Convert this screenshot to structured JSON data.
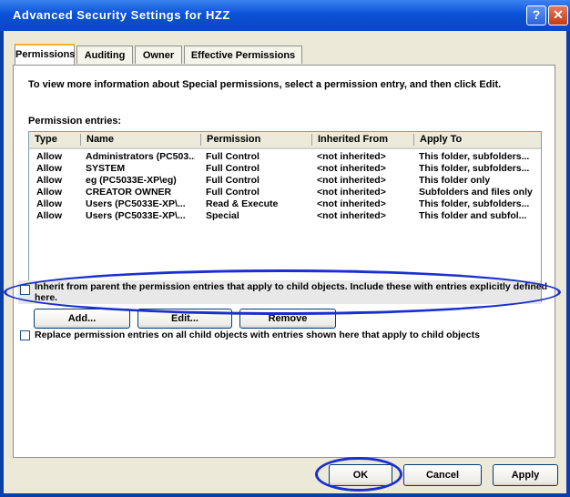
{
  "window": {
    "title": "Advanced Security Settings for HZZ",
    "help_glyph": "?",
    "close_glyph": "✕"
  },
  "tabs": [
    {
      "label": "Permissions"
    },
    {
      "label": "Auditing"
    },
    {
      "label": "Owner"
    },
    {
      "label": "Effective Permissions"
    }
  ],
  "info_text": "To view more information about Special permissions, select a permission entry, and then click Edit.",
  "entries_label": "Permission entries:",
  "columns": [
    "Type",
    "Name",
    "Permission",
    "Inherited From",
    "Apply To"
  ],
  "rows": [
    {
      "type": "Allow",
      "name": "Administrators (PC503...",
      "permission": "Full Control",
      "inherited": "<not inherited>",
      "apply": "This folder, subfolders..."
    },
    {
      "type": "Allow",
      "name": "SYSTEM",
      "permission": "Full Control",
      "inherited": "<not inherited>",
      "apply": "This folder, subfolders..."
    },
    {
      "type": "Allow",
      "name": "eg (PC5033E-XP\\eg)",
      "permission": "Full Control",
      "inherited": "<not inherited>",
      "apply": "This folder only"
    },
    {
      "type": "Allow",
      "name": "CREATOR OWNER",
      "permission": "Full Control",
      "inherited": "<not inherited>",
      "apply": "Subfolders and files only"
    },
    {
      "type": "Allow",
      "name": "Users (PC5033E-XP\\...",
      "permission": "Read & Execute",
      "inherited": "<not inherited>",
      "apply": "This folder, subfolders..."
    },
    {
      "type": "Allow",
      "name": "Users (PC5033E-XP\\...",
      "permission": "Special",
      "inherited": "<not inherited>",
      "apply": "This folder and subfol..."
    }
  ],
  "buttons": {
    "add": "Add...",
    "edit": "Edit...",
    "remove": "Remove"
  },
  "inherit_checkbox": {
    "text": "Inherit from parent the permission entries that apply to child objects. Include these with entries explicitly defined here.",
    "checked": false
  },
  "replace_checkbox": {
    "text": "Replace permission entries on all child objects with entries shown here that apply to child objects",
    "checked": false
  },
  "dialog_buttons": {
    "ok": "OK",
    "cancel": "Cancel",
    "apply": "Apply"
  },
  "annotation_color": "#1a2fd0"
}
